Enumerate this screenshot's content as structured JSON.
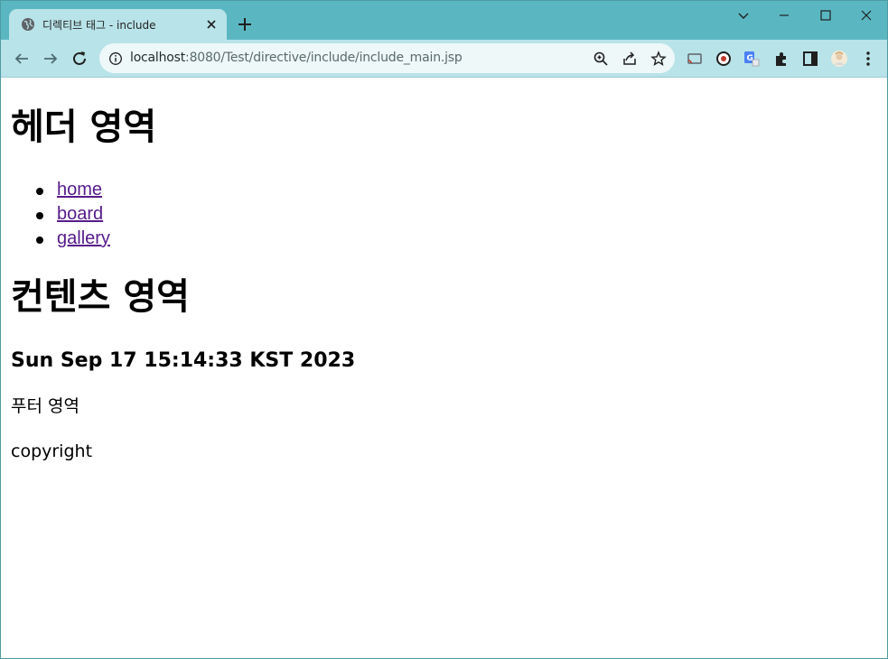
{
  "browser": {
    "tab": {
      "title": "디렉티브 태그 - include",
      "favicon": "globe-icon"
    },
    "url": {
      "host": "localhost",
      "rest": ":8080/Test/directive/include/include_main.jsp"
    },
    "colors": {
      "tabstrip": "#5ab7c2",
      "toolbar": "#b8e3e8",
      "omnibox": "#eef8f9",
      "link_visited": "#551a8b"
    },
    "toolbar_icons": [
      "back-icon",
      "forward-icon",
      "reload-icon",
      "site-info-icon",
      "zoom-icon",
      "share-icon",
      "bookmark-star-icon",
      "cast-icon",
      "extension-record-icon",
      "translate-icon",
      "puzzle-extensions-icon",
      "side-panel-icon",
      "profile-avatar-icon",
      "menu-dots-icon"
    ]
  },
  "page": {
    "header_title": "헤더 영역",
    "nav": [
      {
        "label": "home"
      },
      {
        "label": "board"
      },
      {
        "label": "gallery"
      }
    ],
    "content_title": "컨텐츠 영역",
    "date": "Sun Sep 17 15:14:33 KST 2023",
    "footer_title": "푸터 영역",
    "copyright": "copyright"
  }
}
